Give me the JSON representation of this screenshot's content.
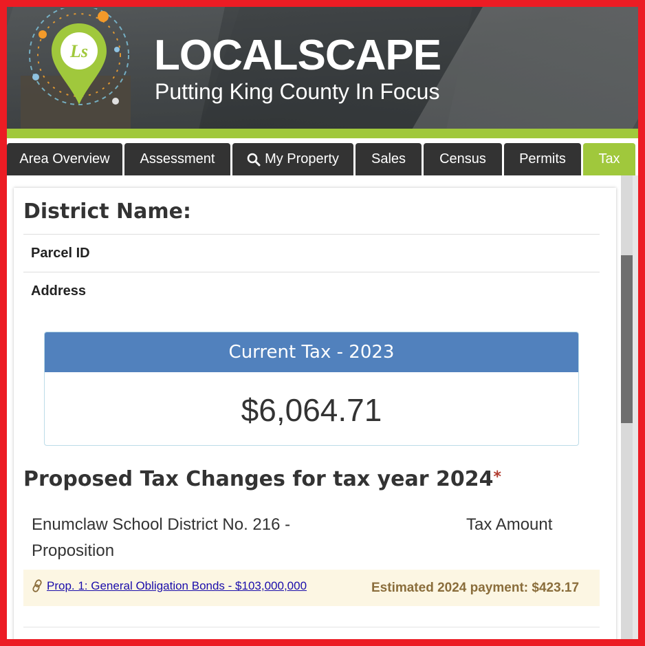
{
  "header": {
    "logo_initials": "Ls",
    "title": "LOCALSCAPE",
    "tagline": "Putting King County In Focus"
  },
  "tabs": [
    {
      "label": "Area Overview",
      "active": false
    },
    {
      "label": "Assessment",
      "active": false
    },
    {
      "label": "My Property",
      "active": false,
      "icon": "search-icon"
    },
    {
      "label": "Sales",
      "active": false
    },
    {
      "label": "Census",
      "active": false
    },
    {
      "label": "Permits",
      "active": false
    },
    {
      "label": "Tax",
      "active": true
    }
  ],
  "property": {
    "district_heading": "District Name:",
    "parcel_label": "Parcel ID",
    "address_label": "Address"
  },
  "current_tax": {
    "heading": "Current Tax - 2023",
    "amount": "$6,064.71"
  },
  "proposed": {
    "heading": "Proposed Tax Changes for tax year 2024",
    "asterisk": "*",
    "district_proposition": "Enumclaw School District No. 216 - Proposition",
    "tax_amount_header": "Tax Amount",
    "items": [
      {
        "link": "Prop. 1: General Obligation Bonds - $103,000,000",
        "estimate": "Estimated 2024 payment: $423.17"
      }
    ]
  },
  "colors": {
    "accent_green": "#a0c83c",
    "tab_dark": "#333333",
    "panel_blue": "#5181bd",
    "frame_red": "#ec1c24",
    "highlight_row": "#fcf6e3",
    "estimate_text": "#8a6d3b"
  }
}
